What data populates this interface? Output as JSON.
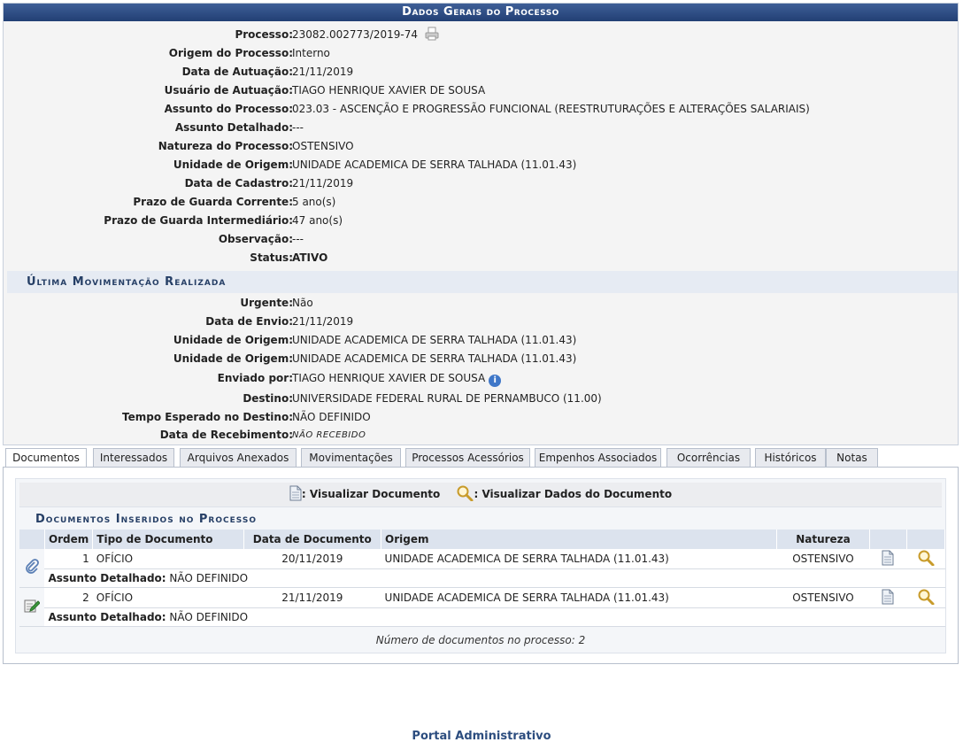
{
  "header": {
    "title": "Dados Gerais do Processo"
  },
  "general": [
    {
      "label": "Processo:",
      "value": "23082.002773/2019-74"
    },
    {
      "label": "Origem do Processo:",
      "value": "Interno"
    },
    {
      "label": "Data de Autuação:",
      "value": "21/11/2019"
    },
    {
      "label": "Usuário de Autuação:",
      "value": "TIAGO HENRIQUE XAVIER DE SOUSA"
    },
    {
      "label": "Assunto do Processo:",
      "value": "023.03 - ASCENÇÃO E PROGRESSÃO FUNCIONAL (REESTRUTURAÇÕES E ALTERAÇÕES SALARIAIS)"
    },
    {
      "label": "Assunto Detalhado:",
      "value": "---"
    },
    {
      "label": "Natureza do Processo:",
      "value": "OSTENSIVO"
    },
    {
      "label": "Unidade de Origem:",
      "value": "UNIDADE ACADEMICA DE SERRA TALHADA (11.01.43)"
    },
    {
      "label": "Data de Cadastro:",
      "value": "21/11/2019"
    },
    {
      "label": "Prazo de Guarda Corrente:",
      "value": "5 ano(s)"
    },
    {
      "label": "Prazo de Guarda Intermediário:",
      "value": "47 ano(s)"
    },
    {
      "label": "Observação:",
      "value": "---"
    },
    {
      "label": "Status:",
      "value": "ATIVO"
    }
  ],
  "last_move": {
    "title": "Última Movimentação Realizada",
    "rows": [
      {
        "label": "Urgente:",
        "value": "Não"
      },
      {
        "label": "Data de Envio:",
        "value": "21/11/2019"
      },
      {
        "label": "Unidade de Origem:",
        "value": "UNIDADE ACADEMICA DE SERRA TALHADA (11.01.43)"
      },
      {
        "label": "Unidade de Origem:",
        "value": "UNIDADE ACADEMICA DE SERRA TALHADA (11.01.43)"
      },
      {
        "label": "Enviado por:",
        "value": "TIAGO HENRIQUE XAVIER DE SOUSA"
      },
      {
        "label": "Destino:",
        "value": "UNIVERSIDADE FEDERAL RURAL DE PERNAMBUCO (11.00)"
      },
      {
        "label": "Tempo Esperado no Destino:",
        "value": "NÃO DEFINIDO"
      },
      {
        "label": "Data de Recebimento:",
        "value": "NÃO RECEBIDO"
      }
    ]
  },
  "tabs": [
    "Documentos",
    "Interessados",
    "Arquivos Anexados",
    "Movimentações",
    "Processos Acessórios",
    "Empenhos Associados",
    "Ocorrências",
    "Históricos",
    "Notas"
  ],
  "legend": {
    "view_doc": ": Visualizar Documento",
    "view_data": ": Visualizar Dados do Documento"
  },
  "docs": {
    "title": "Documentos Inseridos no Processo",
    "columns": [
      "Ordem",
      "Tipo de Documento",
      "Data de Documento",
      "Origem",
      "Natureza"
    ],
    "rows": [
      {
        "ordem": "1",
        "tipo": "OFÍCIO",
        "data": "20/11/2019",
        "origem": "UNIDADE ACADEMICA DE SERRA TALHADA (11.01.43)",
        "natureza": "OSTENSIVO",
        "sub_label": "Assunto Detalhado:",
        "sub_value": "NÃO DEFINIDO",
        "icon": "paperclip-icon"
      },
      {
        "ordem": "2",
        "tipo": "OFÍCIO",
        "data": "21/11/2019",
        "origem": "UNIDADE ACADEMICA DE SERRA TALHADA (11.01.43)",
        "natureza": "OSTENSIVO",
        "sub_label": "Assunto Detalhado:",
        "sub_value": "NÃO DEFINIDO",
        "icon": "edit-document-icon"
      }
    ],
    "count_text": "Número de documentos no processo: 2"
  },
  "footer": {
    "portal": "Portal Administrativo"
  }
}
